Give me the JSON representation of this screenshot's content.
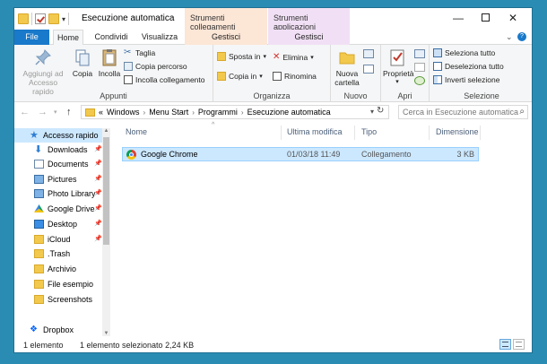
{
  "window": {
    "title": "Esecuzione automatica",
    "ctx_collegamenti": "Strumenti collegamenti",
    "ctx_applicazioni": "Strumenti applicazioni"
  },
  "tabs": {
    "file": "File",
    "home": "Home",
    "condividi": "Condividi",
    "visualizza": "Visualizza",
    "gestisci1": "Gestisci",
    "gestisci2": "Gestisci"
  },
  "ribbon": {
    "appunti": {
      "label": "Appunti",
      "aggiungi_line1": "Aggiungi ad",
      "aggiungi_line2": "Accesso rapido",
      "copia": "Copia",
      "incolla": "Incolla",
      "taglia": "Taglia",
      "copia_percorso": "Copia percorso",
      "incolla_collegamento": "Incolla collegamento"
    },
    "organizza": {
      "label": "Organizza",
      "sposta_in": "Sposta in",
      "copia_in": "Copia in",
      "elimina": "Elimina",
      "rinomina": "Rinomina"
    },
    "nuovo": {
      "label": "Nuovo",
      "nuova_line1": "Nuova",
      "nuova_line2": "cartella"
    },
    "apri": {
      "label": "Apri",
      "proprieta": "Proprietà"
    },
    "selezione": {
      "label": "Selezione",
      "seleziona_tutto": "Seleziona tutto",
      "deseleziona_tutto": "Deseleziona tutto",
      "inverti": "Inverti selezione"
    }
  },
  "address": {
    "prefix": "«",
    "crumbs": [
      "Windows",
      "Menu Start",
      "Programmi",
      "Esecuzione automatica"
    ],
    "search_placeholder": "Cerca in Esecuzione automatica"
  },
  "nav": {
    "items": [
      {
        "label": "Accesso rapido"
      },
      {
        "label": "Downloads"
      },
      {
        "label": "Documents"
      },
      {
        "label": "Pictures"
      },
      {
        "label": "Photo Library"
      },
      {
        "label": "Google Drive"
      },
      {
        "label": "Desktop"
      },
      {
        "label": "iCloud"
      },
      {
        "label": ".Trash"
      },
      {
        "label": "Archivio"
      },
      {
        "label": "File esempio"
      },
      {
        "label": "Screenshots"
      },
      {
        "label": "Dropbox"
      }
    ]
  },
  "columns": {
    "name": "Nome",
    "modified": "Ultima modifica",
    "type": "Tipo",
    "size": "Dimensione"
  },
  "files": [
    {
      "name": "Google Chrome",
      "modified": "01/03/18 11:49",
      "type": "Collegamento",
      "size": "3 KB"
    }
  ],
  "status": {
    "count": "1 elemento",
    "selected": "1 elemento selezionato  2,24 KB"
  },
  "colors": {
    "accent": "#1979ca",
    "selection": "#cce8ff",
    "desktop": "#2b8cb3"
  }
}
